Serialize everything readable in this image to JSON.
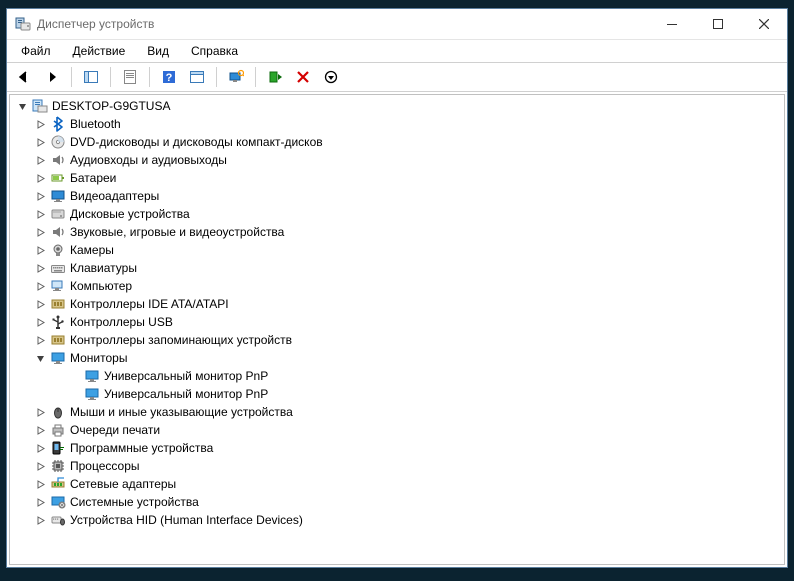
{
  "window": {
    "title": "Диспетчер устройств"
  },
  "menu": {
    "file": "Файл",
    "action": "Действие",
    "view": "Вид",
    "help": "Справка"
  },
  "tree": {
    "root": {
      "label": "DESKTOP-G9GTUSA",
      "expanded": true
    },
    "categories": [
      {
        "label": "Bluetooth",
        "icon": "bluetooth",
        "expanded": false
      },
      {
        "label": "DVD-дисководы и дисководы компакт-дисков",
        "icon": "disc",
        "expanded": false
      },
      {
        "label": "Аудиовходы и аудиовыходы",
        "icon": "audio",
        "expanded": false
      },
      {
        "label": "Батареи",
        "icon": "battery",
        "expanded": false
      },
      {
        "label": "Видеоадаптеры",
        "icon": "display",
        "expanded": false
      },
      {
        "label": "Дисковые устройства",
        "icon": "drive",
        "expanded": false
      },
      {
        "label": "Звуковые, игровые и видеоустройства",
        "icon": "audio",
        "expanded": false
      },
      {
        "label": "Камеры",
        "icon": "camera",
        "expanded": false
      },
      {
        "label": "Клавиатуры",
        "icon": "keyboard",
        "expanded": false
      },
      {
        "label": "Компьютер",
        "icon": "computer",
        "expanded": false
      },
      {
        "label": "Контроллеры IDE ATA/ATAPI",
        "icon": "controller",
        "expanded": false
      },
      {
        "label": "Контроллеры USB",
        "icon": "usb",
        "expanded": false
      },
      {
        "label": "Контроллеры запоминающих устройств",
        "icon": "controller",
        "expanded": false
      },
      {
        "label": "Мониторы",
        "icon": "monitor",
        "expanded": true,
        "children": [
          {
            "label": "Универсальный монитор PnP",
            "icon": "monitor"
          },
          {
            "label": "Универсальный монитор PnP",
            "icon": "monitor"
          }
        ]
      },
      {
        "label": "Мыши и иные указывающие устройства",
        "icon": "mouse",
        "expanded": false
      },
      {
        "label": "Очереди печати",
        "icon": "printer",
        "expanded": false
      },
      {
        "label": "Программные устройства",
        "icon": "software",
        "expanded": false
      },
      {
        "label": "Процессоры",
        "icon": "cpu",
        "expanded": false
      },
      {
        "label": "Сетевые адаптеры",
        "icon": "network",
        "expanded": false
      },
      {
        "label": "Системные устройства",
        "icon": "system",
        "expanded": false
      },
      {
        "label": "Устройства HID (Human Interface Devices)",
        "icon": "hid",
        "expanded": false
      }
    ]
  }
}
